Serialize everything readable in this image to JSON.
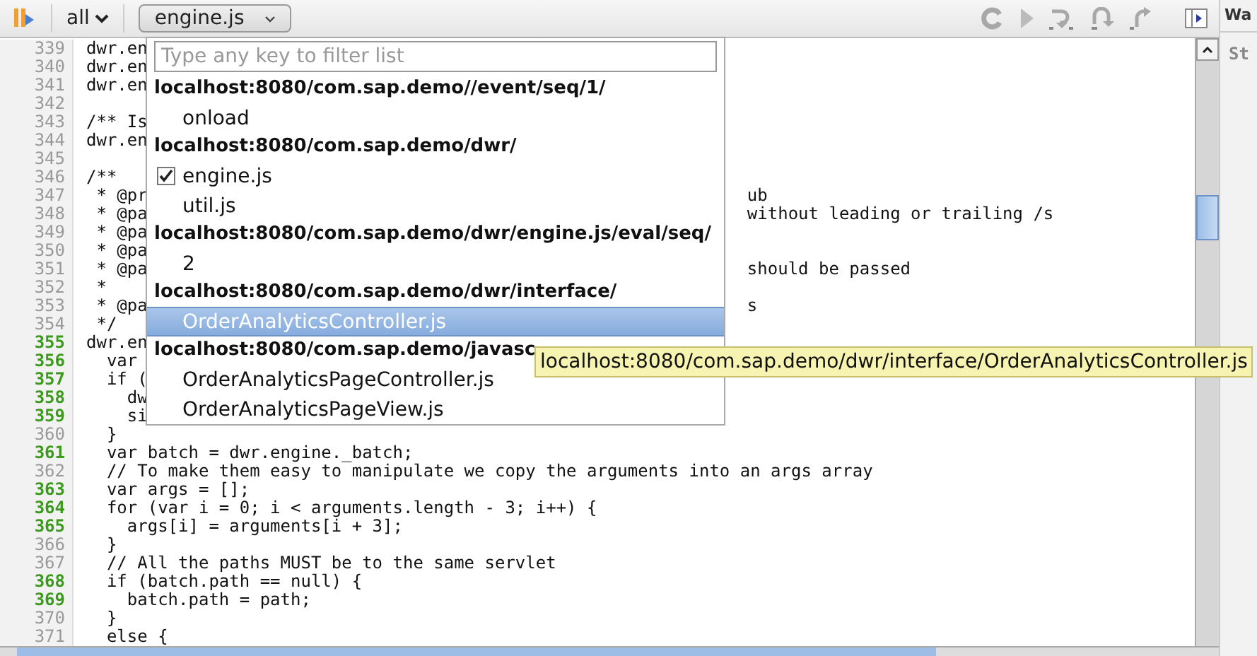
{
  "toolbar": {
    "scope": "all",
    "file": "engine.js"
  },
  "editor": {
    "lines": [
      {
        "number": "339",
        "executable": false,
        "text": "dwr.en"
      },
      {
        "number": "340",
        "executable": false,
        "text": "dwr.en"
      },
      {
        "number": "341",
        "executable": false,
        "text": "dwr.en"
      },
      {
        "number": "342",
        "executable": false
      },
      {
        "number": "343",
        "executable": false,
        "text": "/** Is"
      },
      {
        "number": "344",
        "executable": false,
        "text": "dwr.en"
      },
      {
        "number": "345",
        "executable": false
      },
      {
        "number": "346",
        "executable": false,
        "text": "/**"
      },
      {
        "number": "347",
        "executable": false,
        "text": " * @pr",
        "rest": "ub"
      },
      {
        "number": "348",
        "executable": false,
        "text": " * @pa",
        "rest": "without leading or trailing /s"
      },
      {
        "number": "349",
        "executable": false,
        "text": " * @pa"
      },
      {
        "number": "350",
        "executable": false,
        "text": " * @pa"
      },
      {
        "number": "351",
        "executable": false,
        "text": " * @pa",
        "rest": "should be passed"
      },
      {
        "number": "352",
        "executable": false,
        "text": " *"
      },
      {
        "number": "353",
        "executable": false,
        "text": " * @pa",
        "rest": "s"
      },
      {
        "number": "354",
        "executable": false,
        "text": " */"
      },
      {
        "number": "355",
        "executable": true,
        "text": "dwr.en"
      },
      {
        "number": "356",
        "executable": true,
        "text": "  var"
      },
      {
        "number": "357",
        "executable": true,
        "text": "  if ("
      },
      {
        "number": "358",
        "executable": true,
        "text": "    dw"
      },
      {
        "number": "359",
        "executable": true,
        "text": "    si"
      },
      {
        "number": "360",
        "executable": false,
        "text": "  }"
      },
      {
        "number": "361",
        "executable": true,
        "text": "  var batch = dwr.engine._batch;"
      },
      {
        "number": "362",
        "executable": false,
        "text": "  // To make them easy to manipulate we copy the arguments into an args array"
      },
      {
        "number": "363",
        "executable": true,
        "text": "  var args = [];"
      },
      {
        "number": "364",
        "executable": true,
        "text": "  for (var i = 0; i < arguments.length - 3; i++) {"
      },
      {
        "number": "365",
        "executable": true,
        "text": "    args[i] = arguments[i + 3];"
      },
      {
        "number": "366",
        "executable": false,
        "text": "  }"
      },
      {
        "number": "367",
        "executable": false,
        "text": "  // All the paths MUST be to the same servlet"
      },
      {
        "number": "368",
        "executable": true,
        "text": "  if (batch.path == null) {"
      },
      {
        "number": "369",
        "executable": true,
        "text": "    batch.path = path;"
      },
      {
        "number": "370",
        "executable": false,
        "text": "  }"
      },
      {
        "number": "371",
        "executable": false,
        "text": "  else {"
      }
    ]
  },
  "file_menu": {
    "placeholder": "Type any key to filter list",
    "entries": [
      {
        "kind": "group",
        "label": "localhost:8080/com.sap.demo//event/seq/1/"
      },
      {
        "kind": "file",
        "label": "onload",
        "checked": false,
        "selected": false
      },
      {
        "kind": "group",
        "label": "localhost:8080/com.sap.demo/dwr/"
      },
      {
        "kind": "file",
        "label": "engine.js",
        "checked": true,
        "selected": false
      },
      {
        "kind": "file",
        "label": "util.js",
        "checked": false,
        "selected": false
      },
      {
        "kind": "group",
        "label": "localhost:8080/com.sap.demo/dwr/engine.js/eval/seq/"
      },
      {
        "kind": "file",
        "label": "2",
        "checked": false,
        "selected": false
      },
      {
        "kind": "group",
        "label": "localhost:8080/com.sap.demo/dwr/interface/"
      },
      {
        "kind": "file",
        "label": "OrderAnalyticsController.js",
        "checked": false,
        "selected": true
      },
      {
        "kind": "group",
        "label": "localhost:8080/com.sap.demo/javasc"
      },
      {
        "kind": "file",
        "label": "OrderAnalyticsPageController.js",
        "checked": false,
        "selected": false
      },
      {
        "kind": "file",
        "label": "OrderAnalyticsPageView.js",
        "checked": false,
        "selected": false
      }
    ]
  },
  "tooltip": "localhost:8080/com.sap.demo/dwr/interface/OrderAnalyticsController.js",
  "side_panel": {
    "tab": "Wa",
    "label": "St"
  }
}
